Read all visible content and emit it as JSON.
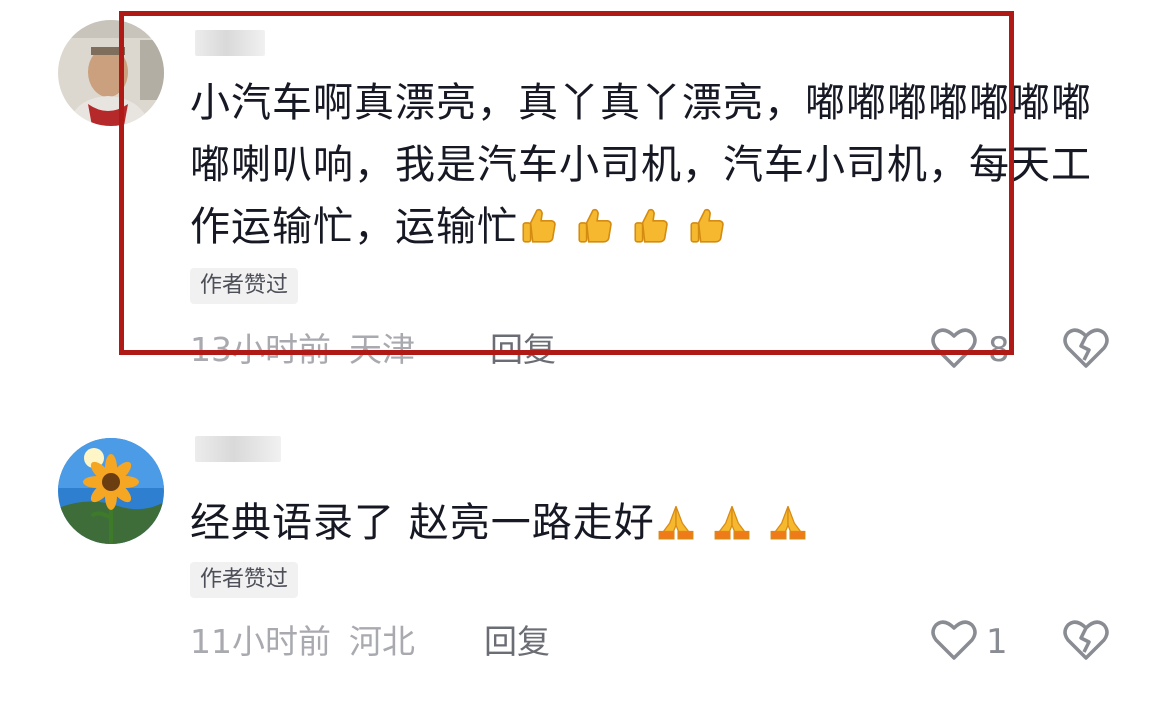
{
  "comments": [
    {
      "username": "",
      "text": "小汽车啊真漂亮，真丫真丫漂亮，嘟嘟嘟嘟嘟嘟嘟嘟喇叭响，我是汽车小司机，汽车小司机，每天工作运输忙，运输忙",
      "emoji": "thumbs-up",
      "emoji_count": 4,
      "badge": "作者赞过",
      "time": "13小时前",
      "location": "天津",
      "reply_label": "回复",
      "likes": "8"
    },
    {
      "username": "",
      "text": "经典语录了 赵亮一路走好",
      "emoji": "folded-hands",
      "emoji_count": 3,
      "badge": "作者赞过",
      "time": "11小时前",
      "location": "河北",
      "reply_label": "回复",
      "likes": "1"
    }
  ],
  "colors": {
    "highlight_border": "#b01a16",
    "meta_text": "#a9aab0",
    "badge_bg": "#f1f1f2"
  }
}
